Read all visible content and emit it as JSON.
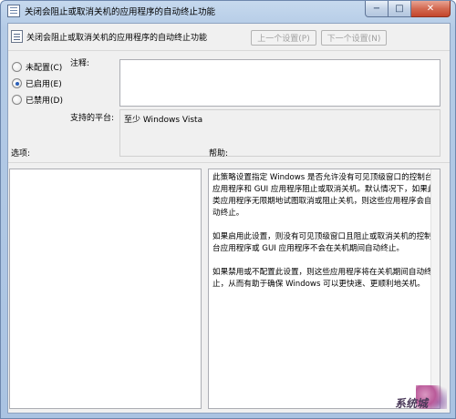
{
  "window": {
    "title": "关闭会阻止或取消关机的应用程序的自动终止功能",
    "caption": {
      "min": "−",
      "max": "□",
      "close": "✕"
    }
  },
  "header": {
    "setting_title": "关闭会阻止或取消关机的应用程序的自动终止功能",
    "prev_label": "上一个设置(P)",
    "next_label": "下一个设置(N)"
  },
  "state": {
    "options": [
      {
        "label": "未配置(C)",
        "checked": false
      },
      {
        "label": "已启用(E)",
        "checked": true
      },
      {
        "label": "已禁用(D)",
        "checked": false
      }
    ]
  },
  "comment": {
    "label": "注释:",
    "value": ""
  },
  "platform": {
    "label": "支持的平台:",
    "value": "至少 Windows Vista"
  },
  "panels": {
    "options_label": "选项:",
    "help_label": "帮助:",
    "help_paragraphs": [
      "此策略设置指定 Windows 是否允许没有可见顶级窗口的控制台应用程序和 GUI 应用程序阻止或取消关机。默认情况下，如果此类应用程序无限期地试图取消或阻止关机，则这些应用程序会自动终止。",
      "如果启用此设置，则没有可见顶级窗口且阻止或取消关机的控制台应用程序或 GUI 应用程序不会在关机期间自动终止。",
      "如果禁用或不配置此设置，则这些应用程序将在关机期间自动终止，从而有助于确保 Windows 可以更快速、更顺利地关机。"
    ]
  },
  "watermark": {
    "text": "系统城"
  },
  "colors": {
    "accent": "#2a5fb8",
    "close": "#c3462c"
  }
}
